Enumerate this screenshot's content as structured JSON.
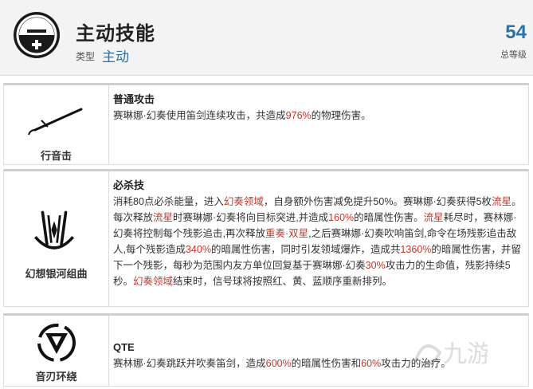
{
  "header": {
    "title": "主动技能",
    "type_label": "类型",
    "type_value": "主动",
    "level": "54",
    "level_label": "总等级",
    "icon": "minus-plus-badge-icon"
  },
  "skills": [
    {
      "label": "行音击",
      "icon": "baton-sword-icon",
      "name": "普通攻击",
      "desc": [
        {
          "t": "赛琳娜·幻奏使用笛剑连续攻击，共造成"
        },
        {
          "t": "976%",
          "red": true
        },
        {
          "t": "的物理伤害。"
        }
      ]
    },
    {
      "label": "幻想银河组曲",
      "icon": "crossed-flutes-icon",
      "name": "必杀技",
      "desc": [
        {
          "t": "消耗80点必杀能量，进入"
        },
        {
          "t": "幻奏领域",
          "red": true
        },
        {
          "t": "，自身额外伤害减免提升50%。赛琳娜·幻奏获得5枚"
        },
        {
          "t": "流星",
          "red": true
        },
        {
          "t": "。每次释放"
        },
        {
          "t": "流星",
          "red": true
        },
        {
          "t": "时赛琳娜·幻奏将向目标突进,并造成"
        },
        {
          "t": "160%",
          "red": true
        },
        {
          "t": "的暗属性伤害。"
        },
        {
          "t": "流星",
          "red": true
        },
        {
          "t": "耗尽时，赛林娜·幻奏将控制每个残影追击,再次释放"
        },
        {
          "t": "重奏·双星",
          "red": true
        },
        {
          "t": ",之后赛琳娜·幻奏吹响笛剑,命令在场残影追击敌人,每个残影造成"
        },
        {
          "t": "340%",
          "red": true
        },
        {
          "t": "的暗属性伤害，同时引发领域爆炸，造成共"
        },
        {
          "t": "1360%",
          "red": true
        },
        {
          "t": "的暗属性伤害，并留下一个残影，每秒为范围内友方单位回复基于赛琳娜·幻奏"
        },
        {
          "t": "30%",
          "red": true
        },
        {
          "t": "攻击力的生命值，残影持续5秒。"
        },
        {
          "t": "幻奏领域",
          "red": true
        },
        {
          "t": "结束时，信号球将按照红、黄、蓝顺序重新排列。"
        }
      ]
    },
    {
      "label": "音刃环绕",
      "icon": "triangle-ring-icon",
      "name": "QTE",
      "desc": [
        {
          "t": "赛林娜·幻奏跳跃并吹奏笛剑，造成"
        },
        {
          "t": "600%",
          "red": true
        },
        {
          "t": "的暗属性伤害和"
        },
        {
          "t": "60%",
          "red": true
        },
        {
          "t": "攻击力的治疗。"
        }
      ]
    }
  ],
  "watermark": "九游"
}
